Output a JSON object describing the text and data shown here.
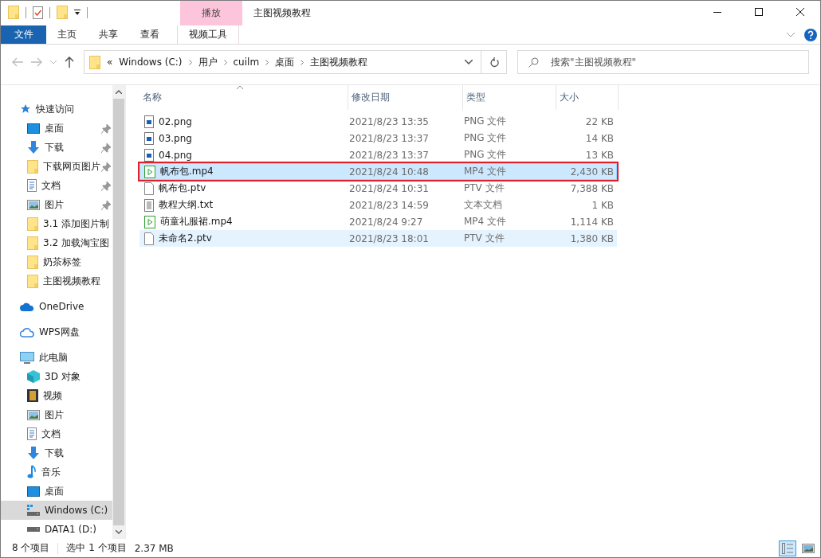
{
  "window": {
    "title": "主图视频教程"
  },
  "quick_toolbar": {
    "items": [
      {
        "kind": "folder"
      },
      {
        "kind": "properties"
      },
      {
        "kind": "new-folder"
      },
      {
        "kind": "dropdown"
      }
    ]
  },
  "ribbon": {
    "context_group": "播放",
    "tabs": [
      {
        "label": "文件",
        "kind": "file",
        "selected": false
      },
      {
        "label": "主页",
        "kind": "tab",
        "selected": false
      },
      {
        "label": "共享",
        "kind": "tab",
        "selected": false
      },
      {
        "label": "查看",
        "kind": "tab",
        "selected": false
      },
      {
        "label": "视频工具",
        "kind": "context",
        "selected": false
      }
    ]
  },
  "address_bar": {
    "overflow": "«",
    "segments": [
      "Windows (C:)",
      "用户",
      "cuilm",
      "桌面",
      "主图视频教程"
    ]
  },
  "search": {
    "placeholder": "搜索\"主图视频教程\""
  },
  "sidebar": {
    "items": [
      {
        "label": "快速访问",
        "kind": "quick",
        "selected": false,
        "children": [
          {
            "label": "桌面",
            "kind": "desktop",
            "pinned": true,
            "selected": false
          },
          {
            "label": "下载",
            "kind": "download",
            "pinned": true,
            "selected": false
          },
          {
            "label": "下载网页图片",
            "kind": "folder",
            "pinned": true,
            "selected": false
          },
          {
            "label": "文档",
            "kind": "document",
            "pinned": true,
            "selected": false
          },
          {
            "label": "图片",
            "kind": "picture",
            "pinned": true,
            "selected": false
          },
          {
            "label": "3.1 添加图片制",
            "kind": "folder",
            "pinned": false,
            "selected": false
          },
          {
            "label": "3.2 加载淘宝图",
            "kind": "folder",
            "pinned": false,
            "selected": false
          },
          {
            "label": "奶茶标签",
            "kind": "folder",
            "pinned": false,
            "selected": false
          },
          {
            "label": "主图视频教程",
            "kind": "folder",
            "pinned": false,
            "selected": false
          }
        ]
      },
      {
        "label": "OneDrive",
        "kind": "onedrive",
        "selected": false
      },
      {
        "label": "WPS网盘",
        "kind": "wps",
        "selected": false
      },
      {
        "label": "此电脑",
        "kind": "pc",
        "selected": false,
        "children": [
          {
            "label": "3D 对象",
            "kind": "cube",
            "pinned": false,
            "selected": false
          },
          {
            "label": "视频",
            "kind": "video",
            "pinned": false,
            "selected": false
          },
          {
            "label": "图片",
            "kind": "picture",
            "pinned": false,
            "selected": false
          },
          {
            "label": "文档",
            "kind": "document",
            "pinned": false,
            "selected": false
          },
          {
            "label": "下载",
            "kind": "download",
            "pinned": false,
            "selected": false
          },
          {
            "label": "音乐",
            "kind": "music",
            "pinned": false,
            "selected": false
          },
          {
            "label": "桌面",
            "kind": "desktop",
            "pinned": false,
            "selected": false
          },
          {
            "label": "Windows (C:)",
            "kind": "windrive",
            "pinned": false,
            "selected": true
          },
          {
            "label": "DATA1 (D:)",
            "kind": "drive",
            "pinned": false,
            "selected": false
          }
        ]
      }
    ]
  },
  "table": {
    "columns": [
      "名称",
      "修改日期",
      "类型",
      "大小"
    ],
    "rows": [
      {
        "name": "02.png",
        "kind": "image",
        "date": "2021/8/23 13:35",
        "type": "PNG 文件",
        "size": "22 KB",
        "selected": false,
        "hovered": false,
        "outlined": false
      },
      {
        "name": "03.png",
        "kind": "image",
        "date": "2021/8/23 13:37",
        "type": "PNG 文件",
        "size": "14 KB",
        "selected": false,
        "hovered": false,
        "outlined": false
      },
      {
        "name": "04.png",
        "kind": "image",
        "date": "2021/8/23 13:37",
        "type": "PNG 文件",
        "size": "13 KB",
        "selected": false,
        "hovered": false,
        "outlined": false
      },
      {
        "name": "帆布包.mp4",
        "kind": "video",
        "date": "2021/8/24 10:48",
        "type": "MP4 文件",
        "size": "2,430 KB",
        "selected": true,
        "hovered": false,
        "outlined": true
      },
      {
        "name": "帆布包.ptv",
        "kind": "blank",
        "date": "2021/8/24 10:31",
        "type": "PTV 文件",
        "size": "7,388 KB",
        "selected": false,
        "hovered": false,
        "outlined": false
      },
      {
        "name": "教程大纲.txt",
        "kind": "text",
        "date": "2021/8/23 14:59",
        "type": "文本文档",
        "size": "1 KB",
        "selected": false,
        "hovered": false,
        "outlined": false
      },
      {
        "name": "萌童礼服裙.mp4",
        "kind": "video",
        "date": "2021/8/24 9:27",
        "type": "MP4 文件",
        "size": "1,114 KB",
        "selected": false,
        "hovered": false,
        "outlined": false
      },
      {
        "name": "未命名2.ptv",
        "kind": "blank",
        "date": "2021/8/23 18:01",
        "type": "PTV 文件",
        "size": "1,380 KB",
        "selected": false,
        "hovered": true,
        "outlined": false
      }
    ]
  },
  "status_bar": {
    "count": "8 个项目",
    "selection": "选中 1 个项目",
    "size": "2.37 MB",
    "views": [
      {
        "kind": "details",
        "selected": true
      },
      {
        "kind": "large-icons",
        "selected": false
      }
    ]
  }
}
